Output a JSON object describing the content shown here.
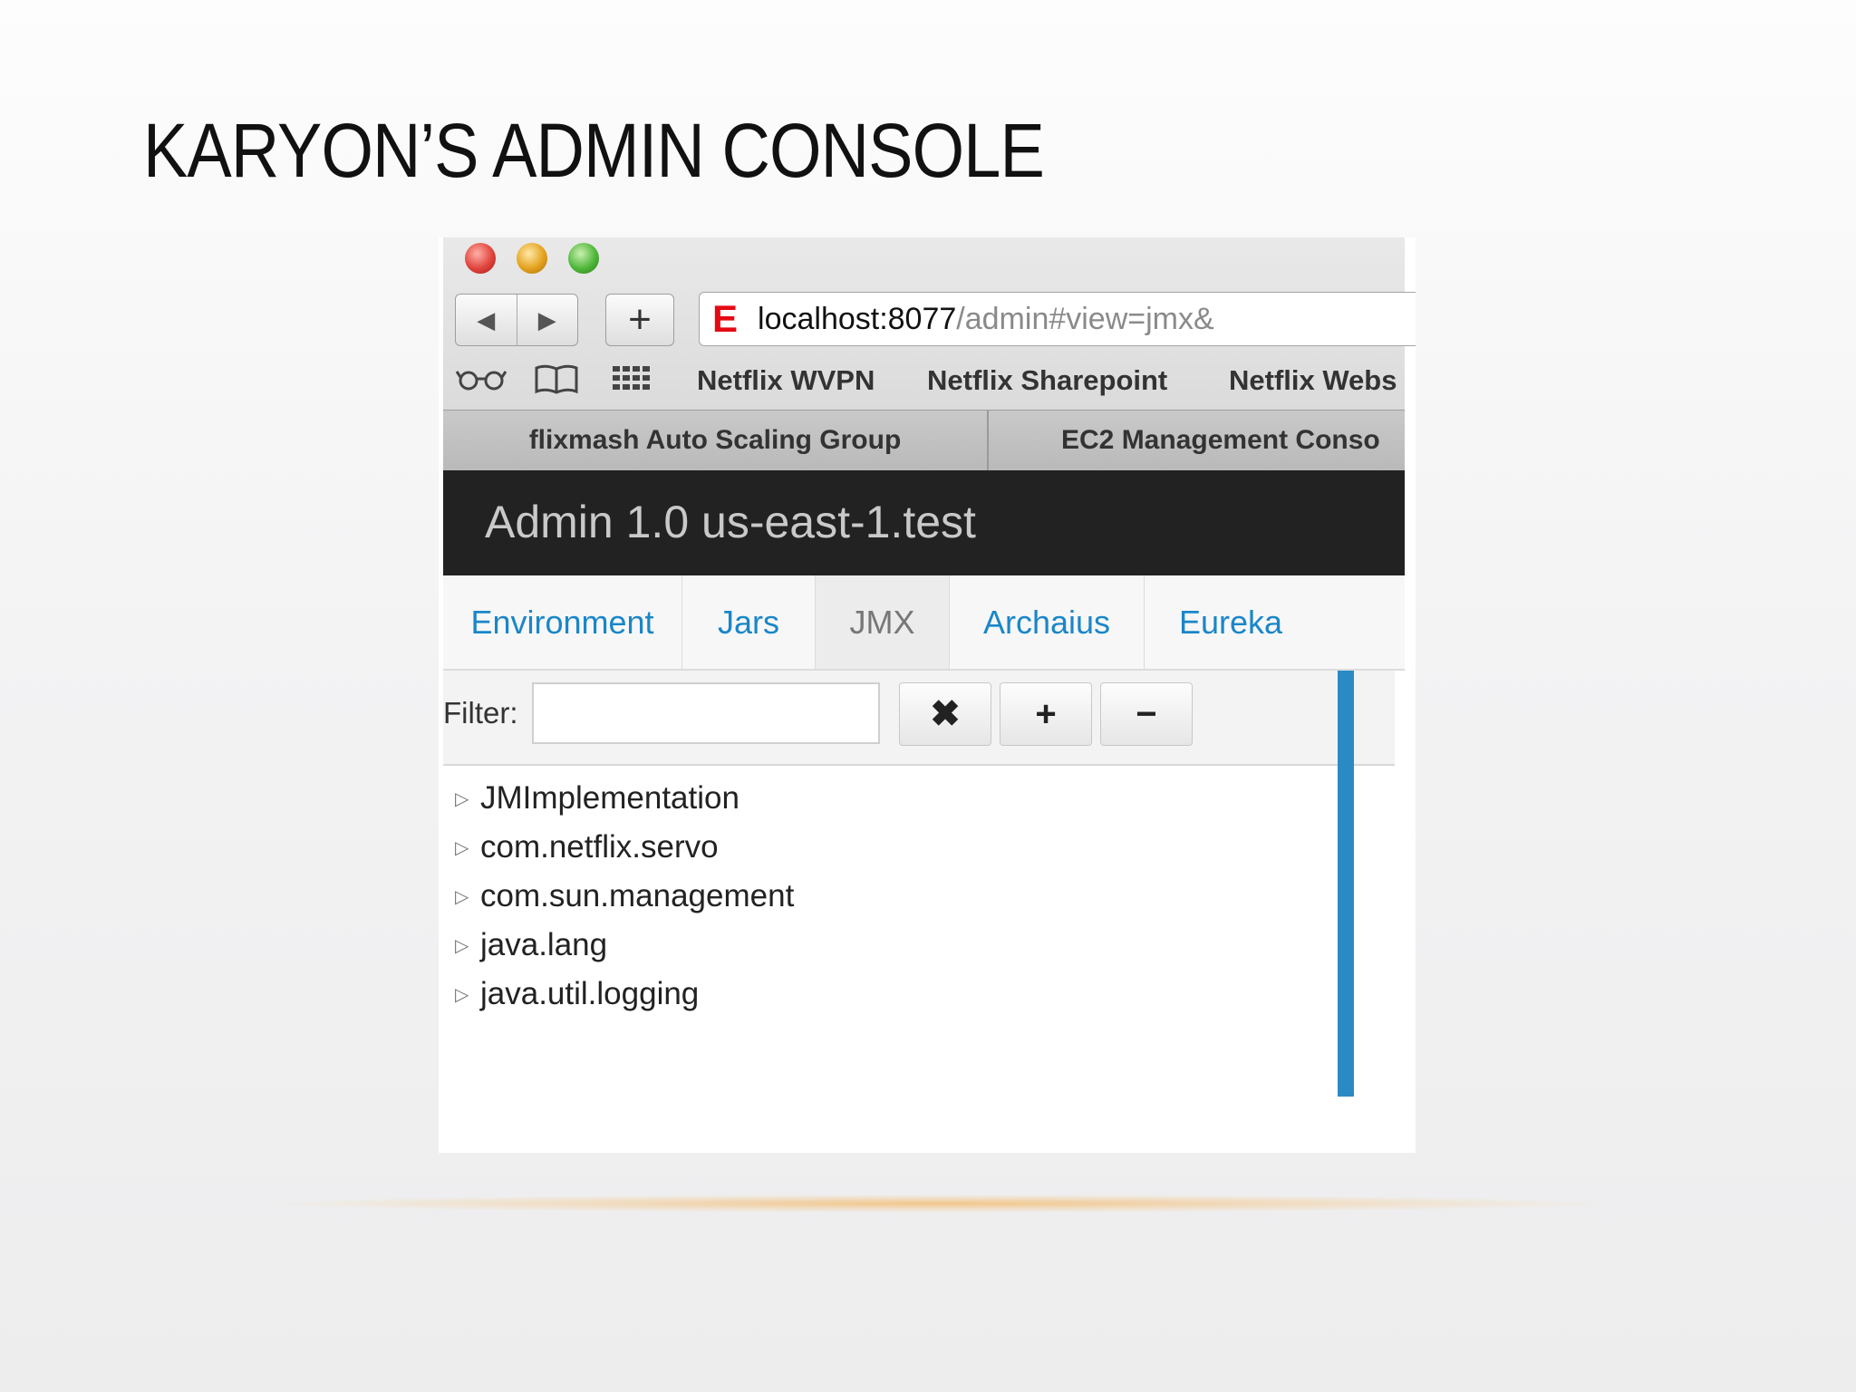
{
  "slide": {
    "title": "KARYON’S ADMIN CONSOLE"
  },
  "browser": {
    "back_glyph": "◀",
    "forward_glyph": "▶",
    "new_tab_glyph": "+",
    "url": {
      "favicon": "E",
      "host": "localhost:8077",
      "path": "/admin#view=jmx&"
    },
    "bookmark_icons": {
      "reading_list": "glasses-icon",
      "bookmarks": "book-icon",
      "top_sites": "grid-icon"
    },
    "bookmarks": [
      "Netflix WVPN",
      "Netflix Sharepoint",
      "Netflix Webs"
    ],
    "tabs": [
      "flixmash Auto Scaling Group",
      "EC2 Management Conso"
    ]
  },
  "app": {
    "title": "Admin 1.0 us-east-1.test",
    "tabs": [
      {
        "label": "Environment",
        "active": false
      },
      {
        "label": "Jars",
        "active": false
      },
      {
        "label": "JMX",
        "active": true
      },
      {
        "label": "Archaius",
        "active": false
      },
      {
        "label": "Eureka",
        "active": false
      }
    ],
    "filter": {
      "label": "Filter:",
      "value": "",
      "clear_glyph": "✖",
      "expand_glyph": "+",
      "collapse_glyph": "−"
    },
    "tree": [
      "JMImplementation",
      "com.netflix.servo",
      "com.sun.management",
      "java.lang",
      "java.util.logging"
    ],
    "accent_color": "#2a8bc4",
    "link_color": "#1a86c8"
  }
}
